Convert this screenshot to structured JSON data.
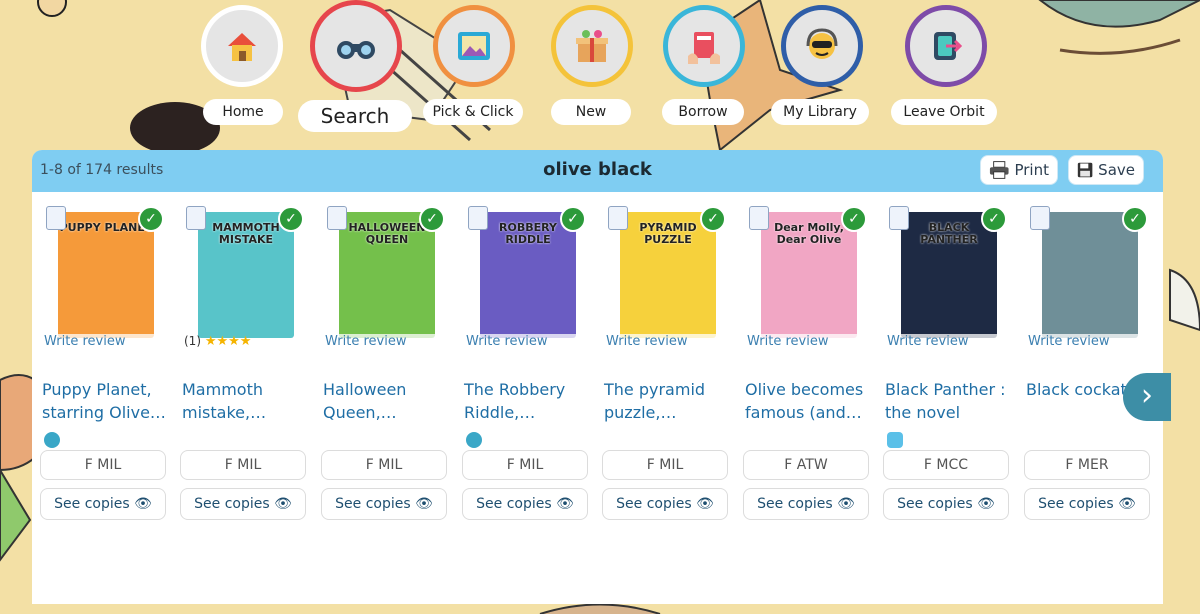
{
  "nav": [
    {
      "label": "Home",
      "icon": "house-icon",
      "ring": "#ffffff"
    },
    {
      "label": "Search",
      "icon": "binoculars-icon",
      "ring": "#e6464c"
    },
    {
      "label": "Pick & Click",
      "icon": "picture-icon",
      "ring": "#f09040"
    },
    {
      "label": "New",
      "icon": "gift-box-icon",
      "ring": "#f4c33a"
    },
    {
      "label": "Borrow",
      "icon": "book-hands-icon",
      "ring": "#3ab6d9"
    },
    {
      "label": "My Library",
      "icon": "astronaut-icon",
      "ring": "#2f5ea8"
    },
    {
      "label": "Leave Orbit",
      "icon": "exit-door-icon",
      "ring": "#7e4ba8"
    }
  ],
  "results": {
    "count_text": "1-8 of 174 results",
    "query": "olive black",
    "print_label": "Print",
    "save_label": "Save"
  },
  "books": [
    {
      "cover_text": "PUPPY PLANET",
      "cover_color": "#f59a3a",
      "review": "Write review",
      "title": "Puppy Planet, starring Olive…",
      "callno": "F MIL",
      "copies": "See copies",
      "format": "audio"
    },
    {
      "cover_text": "MAMMOTH MISTAKE",
      "cover_color": "#58c4c9",
      "rating_count": "(1)",
      "stars": 4,
      "title": "Mammoth mistake,…",
      "callno": "F MIL",
      "copies": "See copies",
      "format": ""
    },
    {
      "cover_text": "HALLOWEEN QUEEN",
      "cover_color": "#74c04b",
      "review": "Write review",
      "title": "Halloween Queen,…",
      "callno": "F MIL",
      "copies": "See copies",
      "format": ""
    },
    {
      "cover_text": "ROBBERY RIDDLE",
      "cover_color": "#6a5cc2",
      "review": "Write review",
      "title": "The Robbery Riddle,…",
      "callno": "F MIL",
      "copies": "See copies",
      "format": "audio"
    },
    {
      "cover_text": "PYRAMID PUZZLE",
      "cover_color": "#f6d13c",
      "review": "Write review",
      "title": "The pyramid puzzle,…",
      "callno": "F MIL",
      "copies": "See copies",
      "format": ""
    },
    {
      "cover_text": "Dear Molly, Dear Olive",
      "cover_color": "#f1a6c4",
      "review": "Write review",
      "title": "Olive becomes famous (and…",
      "callno": "F ATW",
      "copies": "See copies",
      "format": ""
    },
    {
      "cover_text": "BLACK PANTHER",
      "cover_color": "#1e2a44",
      "review": "Write review",
      "title": "Black Panther : the novel",
      "callno": "F MCC",
      "copies": "See copies",
      "format": "ebook"
    },
    {
      "cover_text": "",
      "cover_color": "#6f8f98",
      "review": "Write review",
      "title": "Black cockatoo",
      "callno": "F MER",
      "copies": "See copies",
      "format": ""
    }
  ],
  "next_label": "›"
}
